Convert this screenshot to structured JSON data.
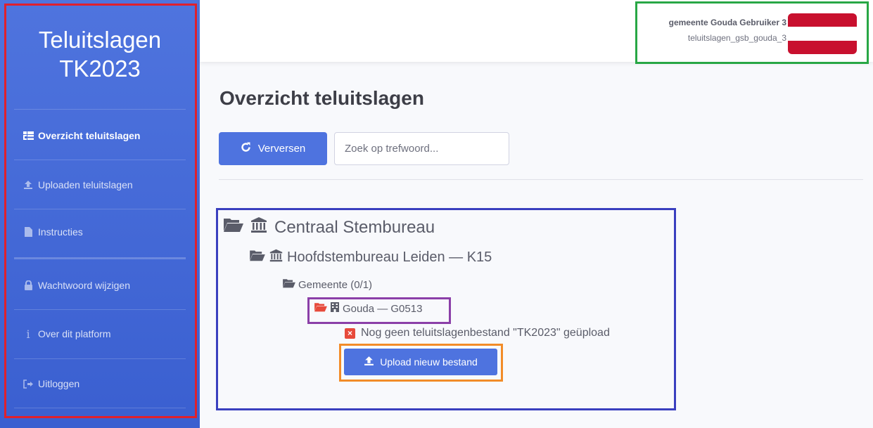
{
  "sidebar": {
    "brand_line1": "Teluitslagen",
    "brand_line2": "TK2023",
    "items": [
      {
        "label": "Overzicht teluitslagen",
        "icon": "sitemap-icon"
      },
      {
        "label": "Uploaden teluitslagen",
        "icon": "upload-icon"
      },
      {
        "label": "Instructies",
        "icon": "file-icon"
      },
      {
        "label": "Wachtwoord wijzigen",
        "icon": "lock-icon"
      },
      {
        "label": "Over dit platform",
        "icon": "info-icon"
      },
      {
        "label": "Uitloggen",
        "icon": "sign-out-icon"
      }
    ],
    "colors": {
      "background": "#4e73df",
      "frame": "#e0202c"
    }
  },
  "topbar": {
    "user_name": "gemeente Gouda Gebruiker 3",
    "account": "teluitslagen_gsb_gouda_3",
    "flag_colors": [
      "#c8102e",
      "#ffffff",
      "#c8102e"
    ],
    "frame_color": "#28a745"
  },
  "main": {
    "title": "Overzicht teluitslagen",
    "refresh_label": "Verversen",
    "search_placeholder": "Zoek op trefwoord..."
  },
  "tree": {
    "root": "Centraal Stembureau",
    "hsb": "Hoofdstembureau Leiden — K15",
    "gemeente": "Gemeente (0/1)",
    "municipality": "Gouda — G0513",
    "status_message": "Nog geen teluitslagenbestand \"TK2023\" geüpload",
    "upload_label": "Upload nieuw bestand",
    "frame_colors": {
      "tree": "#3a3fbf",
      "municipality": "#8b3fa8",
      "upload": "#f28c28"
    },
    "status_color": "#e74a3b"
  }
}
